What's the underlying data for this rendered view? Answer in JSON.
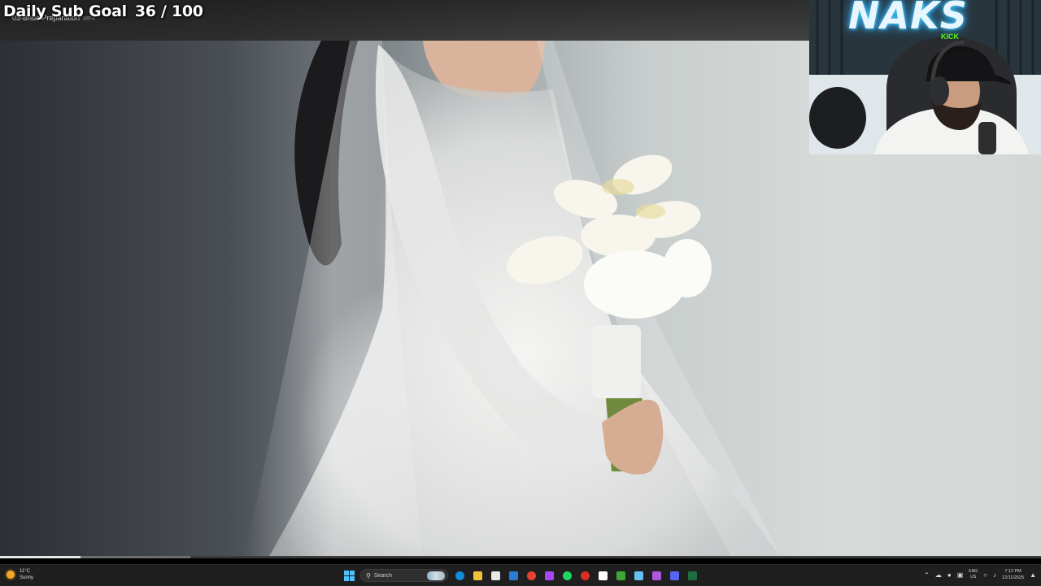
{
  "overlay": {
    "sub_goal_label": "Daily Sub Goal",
    "sub_goal_count": "36 / 100"
  },
  "player": {
    "file_name": "03-Bride Preparation",
    "file_ext": "MP4",
    "progress_fraction": 0.077,
    "buffered_fraction": 0.183
  },
  "webcam": {
    "logo_text": "NAKS",
    "kick_text": "KICK"
  },
  "taskbar": {
    "weather": {
      "temp": "11°C",
      "condition": "Sunny",
      "icon": "sun-icon"
    },
    "search_placeholder": "Search",
    "pinned_apps": [
      {
        "name": "start-button",
        "icon": "windows-logo",
        "color": "#4cc2ff"
      },
      {
        "name": "edge",
        "icon": "edge-icon",
        "color": "#0f8fd9"
      },
      {
        "name": "file-explorer",
        "icon": "folder-icon",
        "color": "#f3c13a"
      },
      {
        "name": "calendar",
        "icon": "calendar-icon",
        "color": "#e8e8e8"
      },
      {
        "name": "mail",
        "icon": "mail-icon",
        "color": "#2b7cd3"
      },
      {
        "name": "chrome",
        "icon": "chrome-icon",
        "color": "#e94235"
      },
      {
        "name": "messenger",
        "icon": "messenger-icon",
        "color": "#a646f5"
      },
      {
        "name": "spotify",
        "icon": "spotify-icon",
        "color": "#1ed760"
      },
      {
        "name": "chrome-profile",
        "icon": "chrome-icon",
        "color": "#d93025"
      },
      {
        "name": "capcut",
        "icon": "capcut-icon",
        "color": "#ffffff"
      },
      {
        "name": "minecraft",
        "icon": "minecraft-icon",
        "color": "#3fa535"
      },
      {
        "name": "steam",
        "icon": "steam-icon",
        "color": "#66c0f4"
      },
      {
        "name": "obs",
        "icon": "obs-icon",
        "color": "#b057e0"
      },
      {
        "name": "discord",
        "icon": "discord-icon",
        "color": "#5865f2"
      },
      {
        "name": "excel",
        "icon": "excel-icon",
        "color": "#1d6f42"
      }
    ],
    "tray": {
      "lang_primary": "ENG",
      "lang_secondary": "US",
      "time": "7:12 PM",
      "date": "12/11/2025"
    }
  }
}
